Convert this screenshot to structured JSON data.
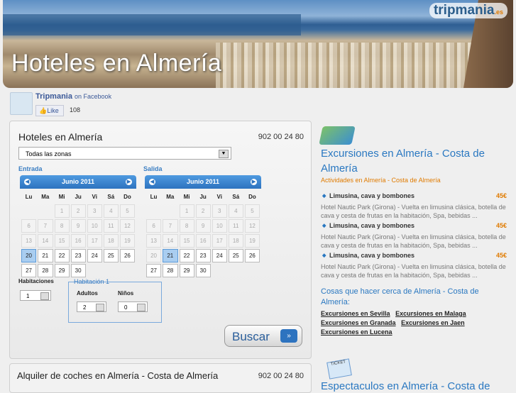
{
  "header": {
    "title": "Hoteles en Almería",
    "logo": "tripmania",
    "logo_suffix": ".es"
  },
  "facebook": {
    "name": "Tripmania",
    "suffix": "on Facebook",
    "like_label": "Like",
    "count": "108"
  },
  "booking": {
    "title": "Hoteles en Almería",
    "phone": "902 00 24 80",
    "zone_select": "Todas las zonas",
    "entrada_label": "Entrada",
    "salida_label": "Salida",
    "calendar_month": "Junio 2011",
    "weekdays": [
      "Lu",
      "Ma",
      "Mi",
      "Ju",
      "Vi",
      "Sá",
      "Do"
    ],
    "weeks": [
      [
        "",
        "",
        "1",
        "2",
        "3",
        "4",
        "5"
      ],
      [
        "6",
        "7",
        "8",
        "9",
        "10",
        "11",
        "12"
      ],
      [
        "13",
        "14",
        "15",
        "16",
        "17",
        "18",
        "19"
      ],
      [
        "20",
        "21",
        "22",
        "23",
        "24",
        "25",
        "26"
      ],
      [
        "27",
        "28",
        "29",
        "30",
        "",
        "",
        ""
      ]
    ],
    "entrada_selected": "20",
    "salida_selected": "21",
    "habitaciones_label": "Habitaciones",
    "habitaciones_value": "1",
    "habitacion1_label": "Habitación 1",
    "adultos_label": "Adultos",
    "adultos_value": "2",
    "ninos_label": "Niños",
    "ninos_value": "0",
    "search_button": "Buscar"
  },
  "car_rental": {
    "title": "Alquiler de coches en Almería - Costa de Almería",
    "phone": "902 00 24 80"
  },
  "excursions": {
    "title": "Excursiones en Almería - Costa de Almería",
    "subtitle": "Actividades en Almería - Costa de Almería",
    "items": [
      {
        "name": "Limusina, cava y bombones",
        "price": "45€",
        "desc": "Hotel Nautic Park (Girona) - Vuelta en limusina clásica, botella de cava y cesta de frutas en la habitación, Spa, bebidas ..."
      },
      {
        "name": "Limusina, cava y bombones",
        "price": "45€",
        "desc": "Hotel Nautic Park (Girona) - Vuelta en limusina clásica, botella de cava y cesta de frutas en la habitación, Spa, bebidas ..."
      },
      {
        "name": "Limusina, cava y bombones",
        "price": "45€",
        "desc": "Hotel Nautic Park (Girona) - Vuelta en limusina clásica, botella de cava y cesta de frutas en la habitación, Spa, bebidas ..."
      }
    ],
    "cosas_title": "Cosas que hacer cerca de Almería - Costa de Almería:",
    "links": [
      "Excursiones en Sevilla",
      "Excursiones en Malaga",
      "Excursiones en Granada",
      "Excursiones en Jaen",
      "Excursiones en Lucena"
    ],
    "ticket_label": "TICKET",
    "bottom_title": "Espectaculos en Almería - Costa de"
  }
}
